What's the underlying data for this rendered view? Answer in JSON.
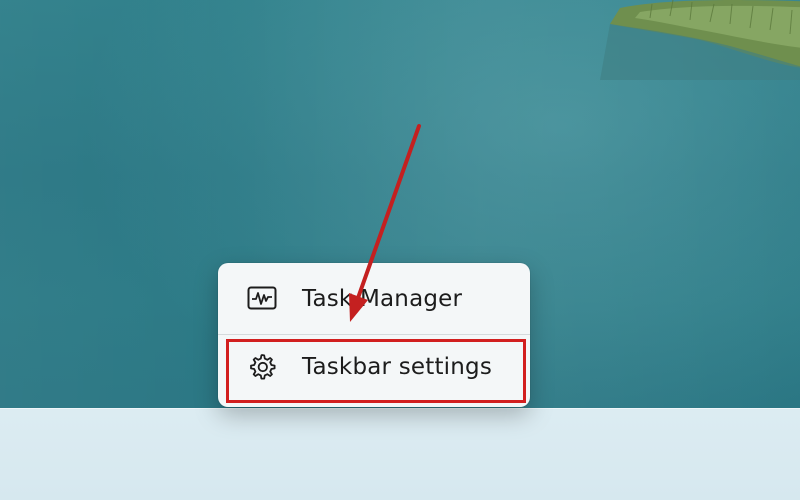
{
  "desktop": {
    "wallpaper": "lake-water-with-reeds"
  },
  "context_menu": {
    "items": [
      {
        "label": "Task Manager",
        "icon": "task-manager-icon"
      },
      {
        "label": "Taskbar settings",
        "icon": "gear-icon"
      }
    ],
    "highlighted_item": "Taskbar settings"
  },
  "annotations": {
    "highlight_color": "#d21f1f",
    "arrow_color": "#d21f1f"
  },
  "colors": {
    "taskbar": "#d8e9f0",
    "menu_background": "#f4f7f8",
    "water": "#2c7a86"
  }
}
